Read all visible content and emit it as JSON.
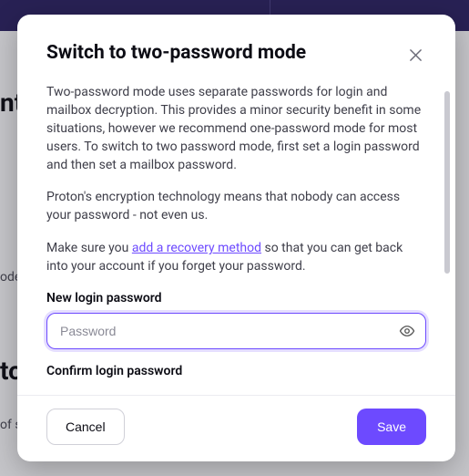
{
  "background": {
    "title1_fragment": "nt",
    "sub1_fragment": "ode",
    "title2_fragment": "to",
    "sub2_fragment": "of s"
  },
  "modal": {
    "title": "Switch to two-password mode",
    "paragraph1": "Two-password mode uses separate passwords for login and mailbox decryption. This provides a minor security benefit in some situations, however we recommend one-password mode for most users. To switch to two password mode, first set a login password and then set a mailbox password.",
    "paragraph2": "Proton's encryption technology means that nobody can access your password - not even us.",
    "paragraph3_pre": "Make sure you ",
    "recovery_link": "add a recovery method",
    "paragraph3_post": " so that you can get back into your account if you forget your password.",
    "new_password_label": "New login password",
    "new_password_placeholder": "Password",
    "new_password_value": "",
    "confirm_password_label": "Confirm login password",
    "cancel": "Cancel",
    "save": "Save"
  }
}
